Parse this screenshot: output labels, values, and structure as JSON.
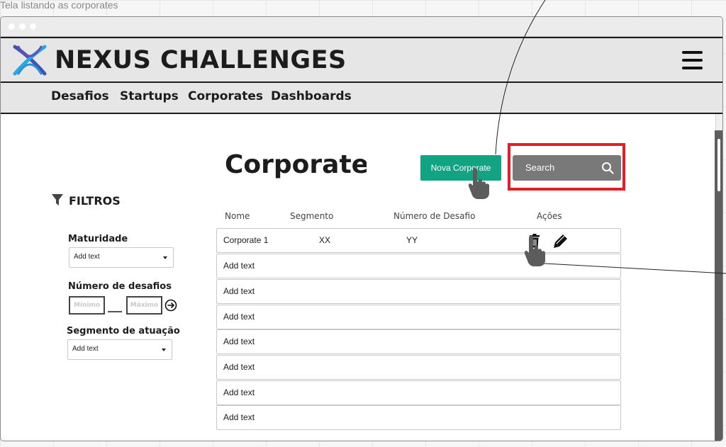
{
  "canvas": {
    "caption": "Tela listando as corporates"
  },
  "header": {
    "brand": "NEXUS CHALLENGES",
    "nav": [
      "Desafios",
      "Startups",
      "Corporates",
      "Dashboards"
    ]
  },
  "main": {
    "title": "Corporates",
    "new_button_label": "Nova Corporate",
    "search_label": "Search"
  },
  "filters": {
    "title": "FILTROS",
    "maturidade": {
      "label": "Maturidade",
      "value": "Add text"
    },
    "numero_desafios": {
      "label": "Número de desafios",
      "min_placeholder": "Mínimo",
      "max_placeholder": "Máximo"
    },
    "segmento": {
      "label": "Segmento de atuação",
      "value": "Add text"
    }
  },
  "table": {
    "columns": [
      "Nome",
      "Segmento",
      "Número de Desafio",
      "Ações"
    ],
    "rows": [
      {
        "nome": "Corporate 1",
        "segmento": "XX",
        "desafios": "YY"
      },
      {
        "nome": "Add text",
        "segmento": "",
        "desafios": ""
      },
      {
        "nome": "Add text",
        "segmento": "",
        "desafios": ""
      },
      {
        "nome": "Add text",
        "segmento": "",
        "desafios": ""
      },
      {
        "nome": "Add text",
        "segmento": "",
        "desafios": ""
      },
      {
        "nome": "Add text",
        "segmento": "",
        "desafios": ""
      },
      {
        "nome": "Add text",
        "segmento": "",
        "desafios": ""
      },
      {
        "nome": "Add text",
        "segmento": "",
        "desafios": ""
      }
    ]
  },
  "colors": {
    "primary_button": "#12a383",
    "search_box": "#797979",
    "highlight": "#e41e26",
    "header_bg": "#e6e6e6"
  },
  "icons": [
    "nexus-logo-icon",
    "hamburger-menu-icon",
    "search-icon",
    "funnel-icon",
    "arrow-right-circle-icon",
    "trash-icon",
    "edit-pencil-icon",
    "hand-pointer-icon"
  ]
}
